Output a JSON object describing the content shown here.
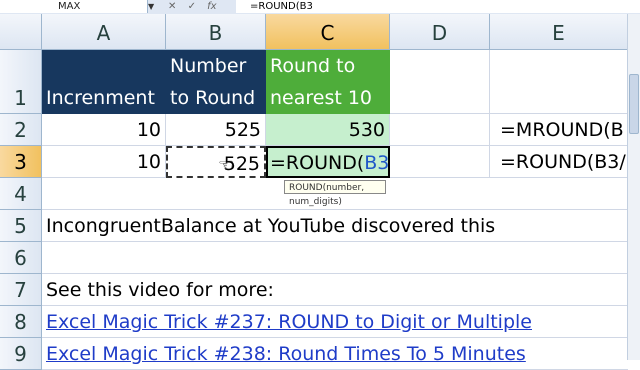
{
  "formula_bar": {
    "name_box": "MAX",
    "formula": "=ROUND(B3"
  },
  "columns": [
    "A",
    "B",
    "C",
    "D",
    "E"
  ],
  "rows": [
    "1",
    "2",
    "3",
    "4",
    "5",
    "6",
    "7",
    "8",
    "9"
  ],
  "cells": {
    "A1": "Increnment",
    "B1_line1": "Number",
    "B1_line2": "to Round",
    "C1_line1": "Round to",
    "C1_line2": "nearest 10",
    "A2": "10",
    "B2": "525",
    "C2": "530",
    "E2": "=MROUND(B",
    "A3": "10",
    "B3": "525",
    "C3_prefix": "=ROUND(",
    "C3_ref": "B3",
    "E3": "=ROUND(B3/",
    "A5": "IncongruentBalance at YouTube discovered this",
    "A7": "See this video for more:",
    "A8": "Excel Magic Trick #237: ROUND to Digit or Multiple",
    "A9": "Excel Magic Trick #238: Round Times To 5 Minutes"
  },
  "tooltip": "ROUND(number, num_digits)",
  "colors": {
    "header_blue": "#17375e",
    "header_green": "#4ead3a",
    "result_green": "#c6efce",
    "link": "#1f3cc8"
  }
}
